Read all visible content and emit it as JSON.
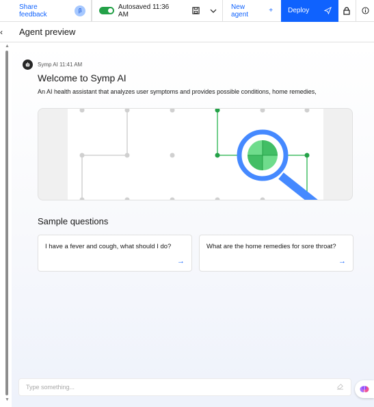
{
  "toolbar": {
    "feedback_label": "Share feedback",
    "beta_badge": "β",
    "autosave_label": "Autosaved 11:36 AM",
    "new_agent_label": "New agent",
    "new_agent_icon": "+",
    "deploy_label": "Deploy",
    "icons": [
      "save-icon",
      "chevron-down-icon",
      "send-icon",
      "lock-icon",
      "info-icon"
    ],
    "accent": "#0f62fe",
    "toggle_color": "#24a148"
  },
  "header": {
    "back_icon": "‹",
    "title": "Agent preview"
  },
  "message": {
    "sender_time": "Symp AI 11:41 AM",
    "title": "Welcome to Symp AI",
    "description": "An AI health assistant that analyzes user symptoms and provides possible conditions, home remedies,"
  },
  "samples": {
    "title": "Sample questions",
    "questions": [
      {
        "text": "I have a fever and cough, what should I do?",
        "arrow": "→"
      },
      {
        "text": "What are the home remedies for sore throat?",
        "arrow": "→"
      }
    ]
  },
  "input": {
    "placeholder": "Type something..."
  }
}
